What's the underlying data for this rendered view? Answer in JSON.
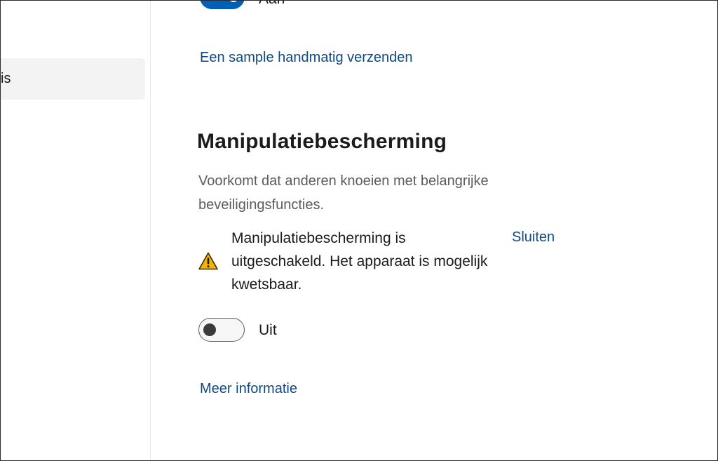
{
  "sidebar": {
    "selected_item_label": "is"
  },
  "sample_submission": {
    "toggle_state_label": "Aan",
    "toggle_on": true,
    "link_label": "Een sample handmatig verzenden"
  },
  "tamper_protection": {
    "title": "Manipulatiebescherming",
    "description": "Voorkomt dat anderen knoeien met belangrijke beveiligingsfuncties.",
    "warning_icon": "warning-triangle-icon",
    "warning_text": "Manipulatiebescherming is uitgeschakeld. Het apparaat is mogelijk kwetsbaar.",
    "dismiss_label": "Sluiten",
    "toggle_on": false,
    "toggle_state_label": "Uit",
    "more_info_label": "Meer informatie"
  },
  "colors": {
    "link": "#0f4a85",
    "accent": "#005fb8",
    "warning": "#f5b400"
  }
}
